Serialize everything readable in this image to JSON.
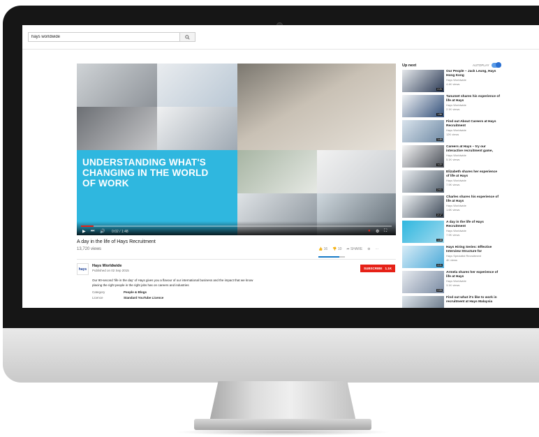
{
  "search": {
    "value": "hays worldwide",
    "button_icon": "search-icon"
  },
  "player": {
    "overlay_title": [
      "UNDERSTANDING WHAT'S",
      "CHANGING IN THE WORLD",
      "OF WORK"
    ],
    "time": "0:02 / 1:48",
    "progress_fraction": 0.04,
    "accent": "#2fb7df"
  },
  "video": {
    "title": "A day in the life of Hays Recruitment",
    "views": "13,720 views",
    "likes": "16",
    "dislikes": "10",
    "share_label": "SHARE"
  },
  "channel": {
    "logo_text": "hays",
    "name": "Hays Worldwide",
    "published": "Published on 02 Sep 2015",
    "subscribe_label": "SUBSCRIBE",
    "subscriber_count": "1.1K",
    "description": "Our 90-second 'life in the day' of Hays gives you a flavour of our international business and the impact that we know placing the right people in the right jobs has on careers and industries",
    "meta": [
      {
        "label": "Category",
        "value": "People & Blogs"
      },
      {
        "label": "Licence",
        "value": "Standard YouTube Licence"
      }
    ]
  },
  "sidebar": {
    "heading": "Up next",
    "autoplay_label": "AUTOPLAY",
    "items": [
      {
        "title": "Our People – Jack Leung, Hays Hong Kong",
        "channel": "Hays Worldwide",
        "views": "4.4K views",
        "duration": "2:20"
      },
      {
        "title": "Tanumet shares his experience of life at Hays",
        "channel": "Hays Worldwide",
        "views": "2.1K views",
        "duration": "1:56"
      },
      {
        "title": "Find out About Careers at Hays Recruitment",
        "channel": "Hays Worldwide",
        "views": "12K views",
        "duration": "1:45"
      },
      {
        "title": "Careers at Hays – try our interactive recruitment game,",
        "channel": "Hays Worldwide",
        "views": "5.1K views",
        "duration": "1:22"
      },
      {
        "title": "Elizabeth shares her experience of life at Hays",
        "channel": "Hays Worldwide",
        "views": "7.9K views",
        "duration": "2:01"
      },
      {
        "title": "Charles shares his experience of life at Hays",
        "channel": "Hays Worldwide",
        "views": "1.6K views",
        "duration": "2:17"
      },
      {
        "title": "A day in the life of Hays Recruitment",
        "channel": "Hays Worldwide",
        "views": "7.9K views",
        "duration": "1:48"
      },
      {
        "title": "Hays Hiring Series: Effective Interview Structure for",
        "channel": "Hays Specialist Recruitment",
        "views": "4K views",
        "duration": "4:41"
      },
      {
        "title": "Armela shares her experience of life at Hays",
        "channel": "Hays Worldwide",
        "views": "3.1K views",
        "duration": "2:05"
      },
      {
        "title": "Find out what it's like to work in recruitment at Hays Malaysia",
        "channel": "",
        "views": "",
        "duration": ""
      }
    ]
  }
}
